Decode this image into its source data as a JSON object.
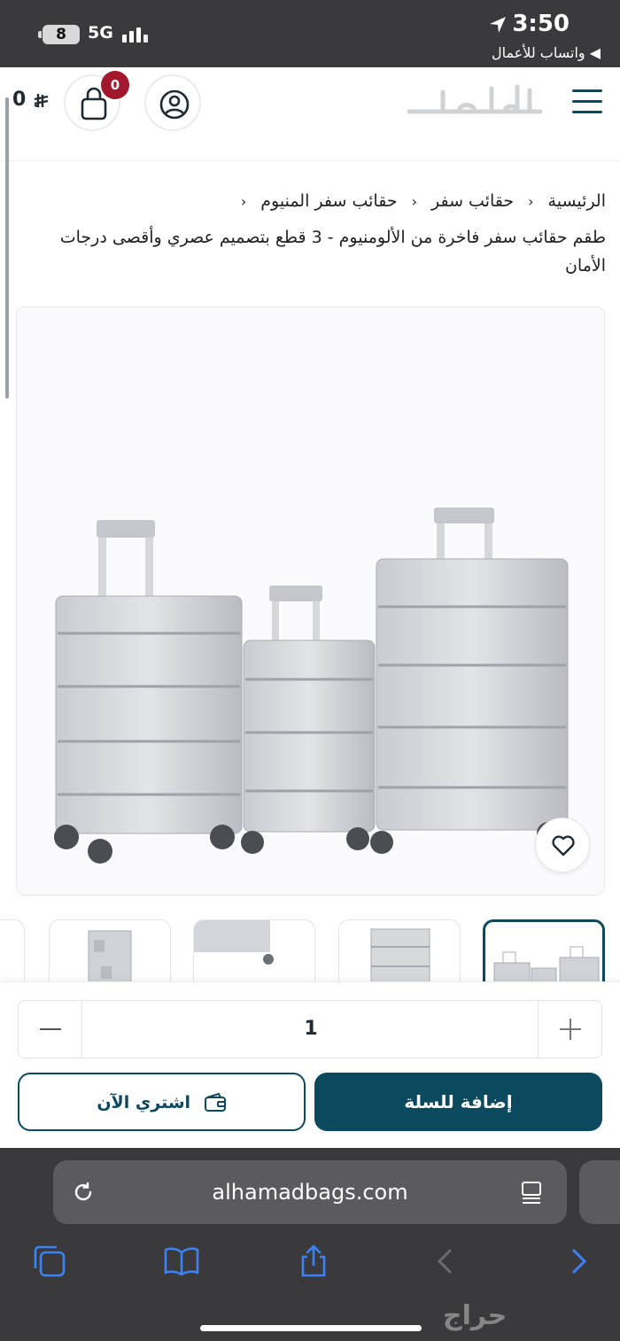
{
  "status_bar": {
    "battery": "8",
    "network": "5G",
    "time": "3:50",
    "back_app": "واتساب للأعمال"
  },
  "header": {
    "cart_total_value": "0",
    "currency_symbol": "⃁",
    "cart_count": "0",
    "logo_text": "الحمد",
    "accent_color": "#0b4a5e",
    "badge_color": "#a1182d"
  },
  "breadcrumb": {
    "items": [
      "الرئيسية",
      "حقائب سفر",
      "حقائب سفر المنيوم"
    ],
    "separator": "‹"
  },
  "product": {
    "title": "طقم حقائب سفر فاخرة من الألومنيوم - 3 قطع بتصميم عصري وأقصى درجات الأمان",
    "quantity": "1",
    "buy_now_label": "اشتري الآن",
    "add_to_cart_label": "إضافة للسلة",
    "thumbnail_count": 5,
    "active_thumbnail": 1
  },
  "browser": {
    "url": "alhamadbags.com",
    "icons": [
      "reload-icon",
      "reader-icon",
      "tabs-icon",
      "bookmarks-icon",
      "share-icon",
      "back-icon",
      "forward-icon"
    ]
  },
  "watermark": "حراج"
}
